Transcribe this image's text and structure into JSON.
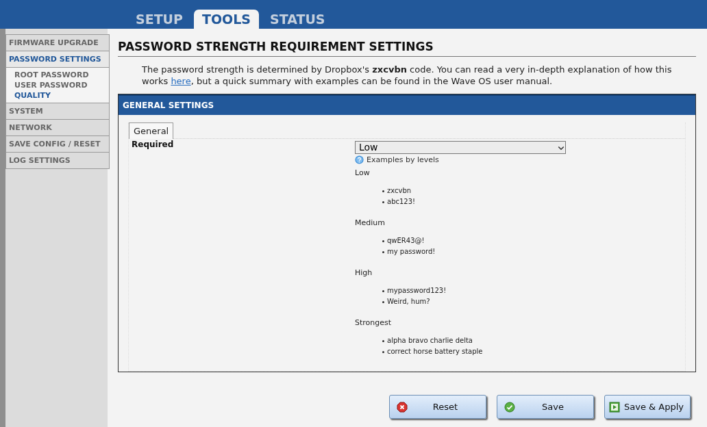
{
  "top_tabs": [
    {
      "label": "SETUP",
      "selected": false
    },
    {
      "label": "TOOLS",
      "selected": true
    },
    {
      "label": "STATUS",
      "selected": false
    }
  ],
  "sidebar": {
    "items": [
      {
        "label": "FIRMWARE UPGRADE",
        "selected": false
      },
      {
        "label": "PASSWORD SETTINGS",
        "selected": true,
        "children": [
          {
            "label": "ROOT PASSWORD",
            "selected": false
          },
          {
            "label": "USER PASSWORD",
            "selected": false
          },
          {
            "label": "QUALITY",
            "selected": true
          }
        ]
      },
      {
        "label": "SYSTEM",
        "selected": false
      },
      {
        "label": "NETWORK",
        "selected": false
      },
      {
        "label": "SAVE CONFIG / RESET",
        "selected": false
      },
      {
        "label": "LOG SETTINGS",
        "selected": false
      }
    ]
  },
  "page_title": "PASSWORD STRENGTH REQUIREMENT SETTINGS",
  "description": {
    "before": "The password strength is determined by Dropbox's **zxcvbn** code. You can read a very in-depth explanation of how this works ",
    "link": "here",
    "after": ", but a quick summary with examples can be found in the Wave OS user manual."
  },
  "panel": {
    "title": "GENERAL SETTINGS",
    "tabs": [
      {
        "label": "General",
        "selected": true
      }
    ],
    "field": {
      "label": "Required",
      "value": "Low"
    },
    "help": "Examples by levels",
    "levels": [
      {
        "name": "Low",
        "examples": [
          "zxcvbn",
          "abc123!"
        ]
      },
      {
        "name": "Medium",
        "examples": [
          "qwER43@!",
          "my password!"
        ]
      },
      {
        "name": "High",
        "examples": [
          "mypassword123!",
          "Weird, hum?"
        ]
      },
      {
        "name": "Strongest",
        "examples": [
          "alpha bravo charlie delta",
          "correct horse battery staple"
        ]
      }
    ]
  },
  "buttons": [
    {
      "kind": "reset",
      "label": "Reset"
    },
    {
      "kind": "save",
      "label": "Save"
    },
    {
      "kind": "apply",
      "label": "Save & Apply"
    }
  ]
}
